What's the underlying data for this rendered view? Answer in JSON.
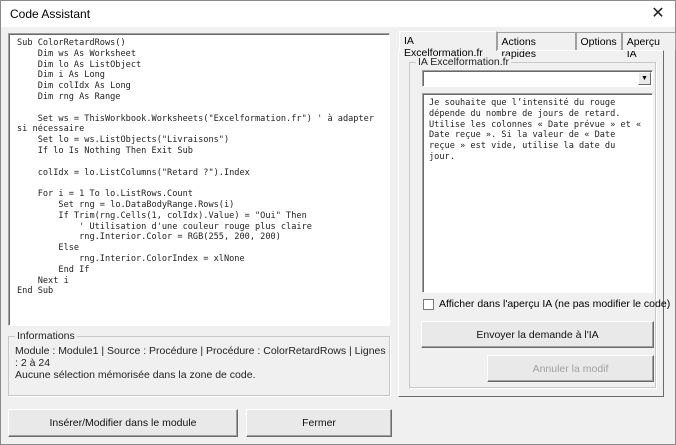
{
  "window": {
    "title": "Code Assistant",
    "close_icon": "close-icon"
  },
  "code": {
    "text": "Sub ColorRetardRows()\n    Dim ws As Worksheet\n    Dim lo As ListObject\n    Dim i As Long\n    Dim colIdx As Long\n    Dim rng As Range\n\n    Set ws = ThisWorkbook.Worksheets(\"Excelformation.fr\") ' à adapter si nécessaire\n    Set lo = ws.ListObjects(\"Livraisons\")\n    If lo Is Nothing Then Exit Sub\n\n    colIdx = lo.ListColumns(\"Retard ?\").Index\n\n    For i = 1 To lo.ListRows.Count\n        Set rng = lo.DataBodyRange.Rows(i)\n        If Trim(rng.Cells(1, colIdx).Value) = \"Oui\" Then\n            ' Utilisation d'une couleur rouge plus claire\n            rng.Interior.Color = RGB(255, 200, 200)\n        Else\n            rng.Interior.ColorIndex = xlNone\n        End If\n    Next i\nEnd Sub"
  },
  "info": {
    "label": "Informations",
    "line1": "Module : Module1 | Source : Procédure | Procédure : ColorRetardRows | Lignes : 2 à 24",
    "line2": "Aucune sélection mémorisée dans la zone de code."
  },
  "buttons": {
    "insert": "Insérer/Modifier dans le module",
    "close": "Fermer",
    "send": "Envoyer la demande à l'IA",
    "undo": "Annuler la modif"
  },
  "tabs": [
    {
      "label": "IA Excelformation.fr",
      "active": true
    },
    {
      "label": "Actions rapides"
    },
    {
      "label": "Options"
    },
    {
      "label": "Aperçu IA"
    }
  ],
  "ia": {
    "frame_label": "IA Excelformation.fr",
    "combo_value": "",
    "prompt": "Je souhaite que l’intensité du rouge dépende du nombre de jours de retard. Utilise les colonnes « Date prévue » et « Date reçue ». Si la valeur de « Date reçue » est vide, utilise la date du jour.",
    "checkbox_label": "Afficher dans l'aperçu IA (ne pas modifier le code)",
    "checkbox_checked": false
  }
}
